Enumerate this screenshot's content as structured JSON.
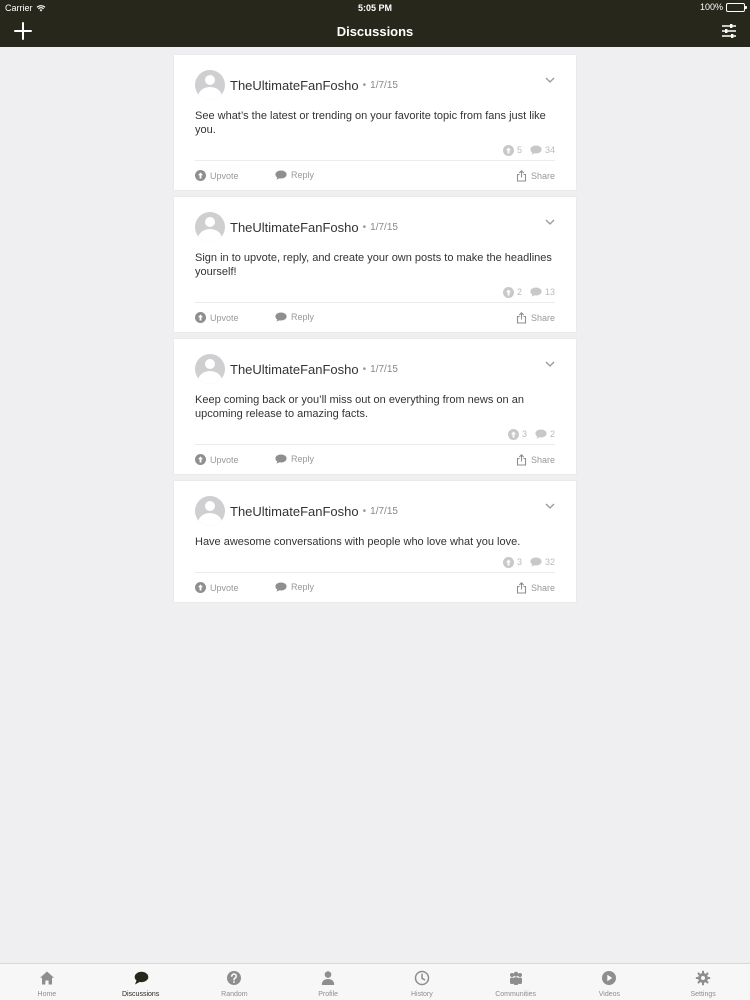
{
  "status_bar": {
    "carrier": "Carrier",
    "time": "5:05 PM",
    "battery": "100%"
  },
  "nav": {
    "title": "Discussions",
    "left_icon": "plus-icon",
    "right_icon": "filter-icon"
  },
  "posts": [
    {
      "author": "TheUltimateFanFosho",
      "separator": "•",
      "date": "1/7/15",
      "body": "See what’s the latest or trending on your favorite topic from fans just like you.",
      "upvotes": "5",
      "comments": "34",
      "upvote_label": "Upvote",
      "reply_label": "Reply",
      "share_label": "Share"
    },
    {
      "author": "TheUltimateFanFosho",
      "separator": "•",
      "date": "1/7/15",
      "body": "Sign in to upvote, reply, and create your own posts to make the headlines yourself!",
      "upvotes": "2",
      "comments": "13",
      "upvote_label": "Upvote",
      "reply_label": "Reply",
      "share_label": "Share"
    },
    {
      "author": "TheUltimateFanFosho",
      "separator": "•",
      "date": "1/7/15",
      "body": "Keep coming back or you’ll miss out on everything from news on an upcoming release to amazing facts.",
      "upvotes": "3",
      "comments": "2",
      "upvote_label": "Upvote",
      "reply_label": "Reply",
      "share_label": "Share"
    },
    {
      "author": "TheUltimateFanFosho",
      "separator": "•",
      "date": "1/7/15",
      "body": "Have awesome conversations with people who love what you love.",
      "upvotes": "3",
      "comments": "32",
      "upvote_label": "Upvote",
      "reply_label": "Reply",
      "share_label": "Share"
    }
  ],
  "tabs": [
    {
      "label": "Home",
      "icon": "home-icon"
    },
    {
      "label": "Discussions",
      "icon": "discussions-icon",
      "active": true
    },
    {
      "label": "Random",
      "icon": "random-icon"
    },
    {
      "label": "Profile",
      "icon": "profile-icon"
    },
    {
      "label": "History",
      "icon": "history-icon"
    },
    {
      "label": "Communities",
      "icon": "communities-icon"
    },
    {
      "label": "Videos",
      "icon": "videos-icon"
    },
    {
      "label": "Settings",
      "icon": "settings-icon"
    }
  ],
  "colors": {
    "nav_background": "#27271b",
    "page_background": "#efeff1",
    "tab_inactive": "#8e8e8e",
    "tab_active": "#27271b"
  }
}
